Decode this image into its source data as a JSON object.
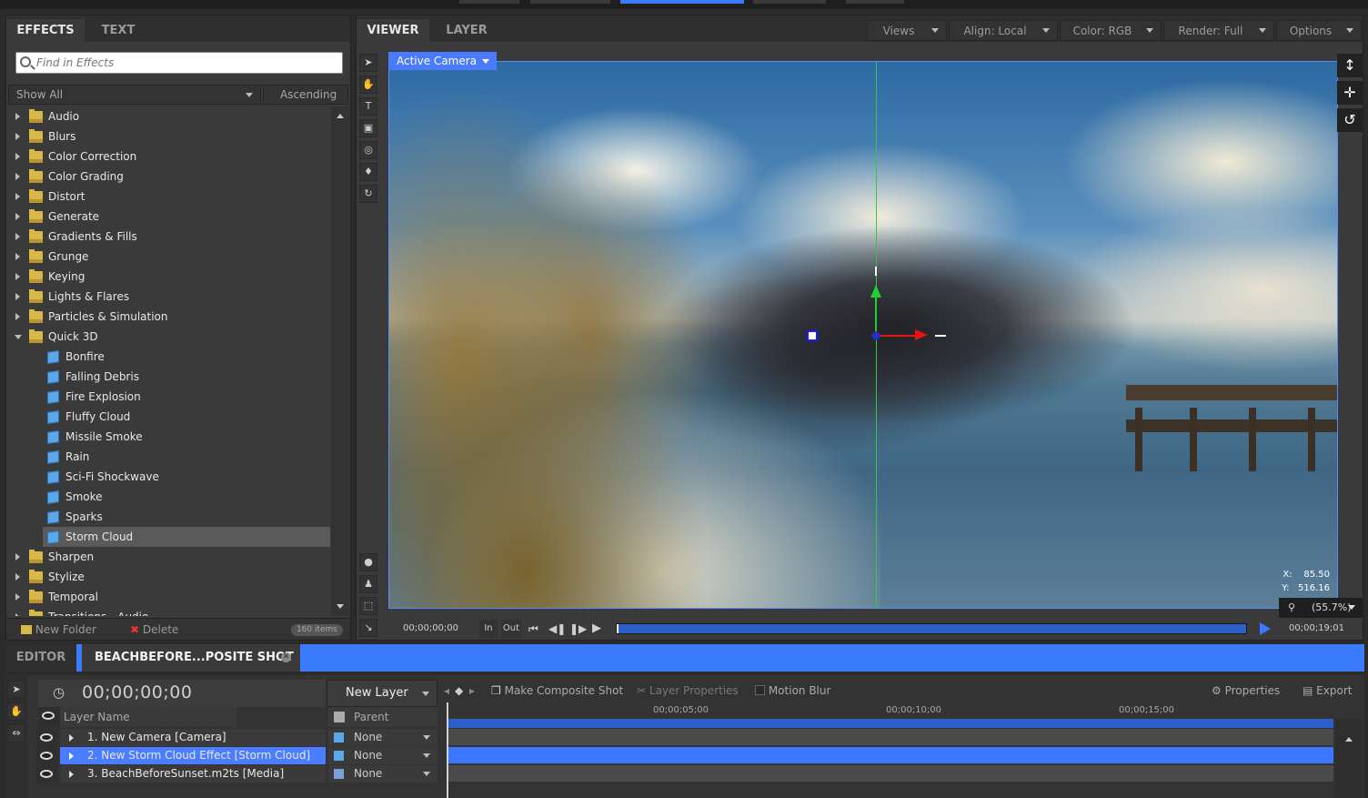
{
  "effects_panel": {
    "tabs": [
      "EFFECTS",
      "TEXT"
    ],
    "search_placeholder": "Find in Effects",
    "filter": "Show All",
    "sort": "Ascending",
    "categories": [
      {
        "label": "Audio",
        "open": false
      },
      {
        "label": "Blurs",
        "open": false
      },
      {
        "label": "Color Correction",
        "open": false
      },
      {
        "label": "Color Grading",
        "open": false
      },
      {
        "label": "Distort",
        "open": false
      },
      {
        "label": "Generate",
        "open": false
      },
      {
        "label": "Gradients & Fills",
        "open": false
      },
      {
        "label": "Grunge",
        "open": false
      },
      {
        "label": "Keying",
        "open": false
      },
      {
        "label": "Lights & Flares",
        "open": false
      },
      {
        "label": "Particles & Simulation",
        "open": false
      },
      {
        "label": "Quick 3D",
        "open": true
      }
    ],
    "quick3d_items": [
      "Bonfire",
      "Falling Debris",
      "Fire Explosion",
      "Fluffy Cloud",
      "Missile Smoke",
      "Rain",
      "Sci-Fi Shockwave",
      "Smoke",
      "Sparks",
      "Storm Cloud"
    ],
    "selected_item": "Storm Cloud",
    "more_categories": [
      "Sharpen",
      "Stylize",
      "Temporal",
      "Transitions - Audio"
    ],
    "new_folder": "New Folder",
    "delete": "Delete",
    "count": "160 items"
  },
  "viewer": {
    "tabs": [
      "VIEWER",
      "LAYER"
    ],
    "options": [
      "Views",
      "Align: Local",
      "Color: RGB",
      "Render: Full",
      "Options"
    ],
    "camera": "Active Camera",
    "coord_x_label": "X:",
    "coord_x": "85.50",
    "coord_y_label": "Y:",
    "coord_y": "516.16",
    "zoom": "(55.7%)",
    "tc_start": "00;00;00;00",
    "in_label": "In",
    "out_label": "Out",
    "tc_end": "00;00;19;01"
  },
  "bottom": {
    "editor_tab": "EDITOR",
    "shot_tab": "BEACHBEFORE...POSITE SHOT",
    "timecode": "00;00;00;00",
    "new_layer": "New Layer",
    "col_layer": "Layer Name",
    "col_parent": "Parent",
    "layers": [
      {
        "name": "1. New Camera [Camera]",
        "parent": "None",
        "selected": false
      },
      {
        "name": "2. New Storm Cloud Effect [Storm Cloud]",
        "parent": "None",
        "selected": true
      },
      {
        "name": "3. BeachBeforeSunset.m2ts [Media]",
        "parent": "None",
        "selected": false
      }
    ],
    "make_composite": "Make Composite Shot",
    "layer_properties": "Layer Properties",
    "motion_blur": "Motion Blur",
    "properties": "Properties",
    "export": "Export",
    "ruler": [
      "00;00;05;00",
      "00;00;10;00",
      "00;00;15;00"
    ]
  },
  "colors": {
    "accent": "#3b7cff",
    "panel": "#3a3a3a",
    "folder": "#d9b84a",
    "cube": "#5aa8ea"
  }
}
